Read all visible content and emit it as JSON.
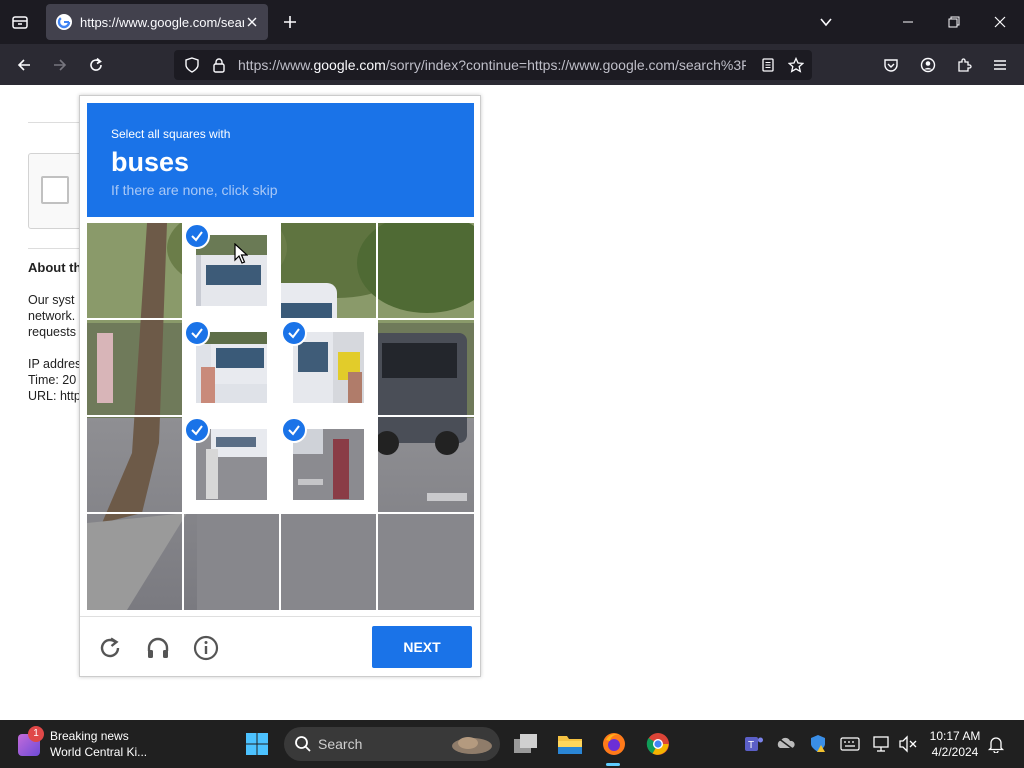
{
  "browser": {
    "tab_title": "https://www.google.com/search?",
    "url_prefix": "https://www.",
    "url_domain": "google.com",
    "url_rest": "/sorry/index?continue=https://www.google.com/search%3F",
    "icons": [
      "tab-list-icon",
      "google-favicon",
      "close-icon",
      "plus-icon",
      "chevron-down-icon",
      "minimize-icon",
      "restore-icon",
      "close-window-icon",
      "back-icon",
      "forward-icon",
      "reload-icon",
      "shield-icon",
      "lock-icon",
      "reader-view-icon",
      "star-icon",
      "pocket-icon",
      "account-icon",
      "extensions-icon",
      "menu-icon"
    ]
  },
  "page": {
    "about_title": "About th",
    "about_lines": [
      "Our syst",
      "network.",
      "requests"
    ],
    "info_lines": [
      "IP addres",
      "Time: 20",
      "URL: http"
    ]
  },
  "challenge": {
    "subtitle": "Select all squares with",
    "target": "buses",
    "hint": "If there are none, click skip",
    "next_label": "NEXT",
    "selected_tiles": [
      1,
      5,
      6,
      9,
      10
    ],
    "footer_icons": [
      "reload-icon",
      "headphones-icon",
      "info-icon"
    ]
  },
  "taskbar": {
    "news_badge": "1",
    "news_title": "Breaking news",
    "news_subtitle": "World Central Ki...",
    "search_label": "Search",
    "time": "10:17 AM",
    "date": "4/2/2024",
    "colors": {
      "accent": "#1a73e8",
      "taskbar": "#202020"
    }
  }
}
